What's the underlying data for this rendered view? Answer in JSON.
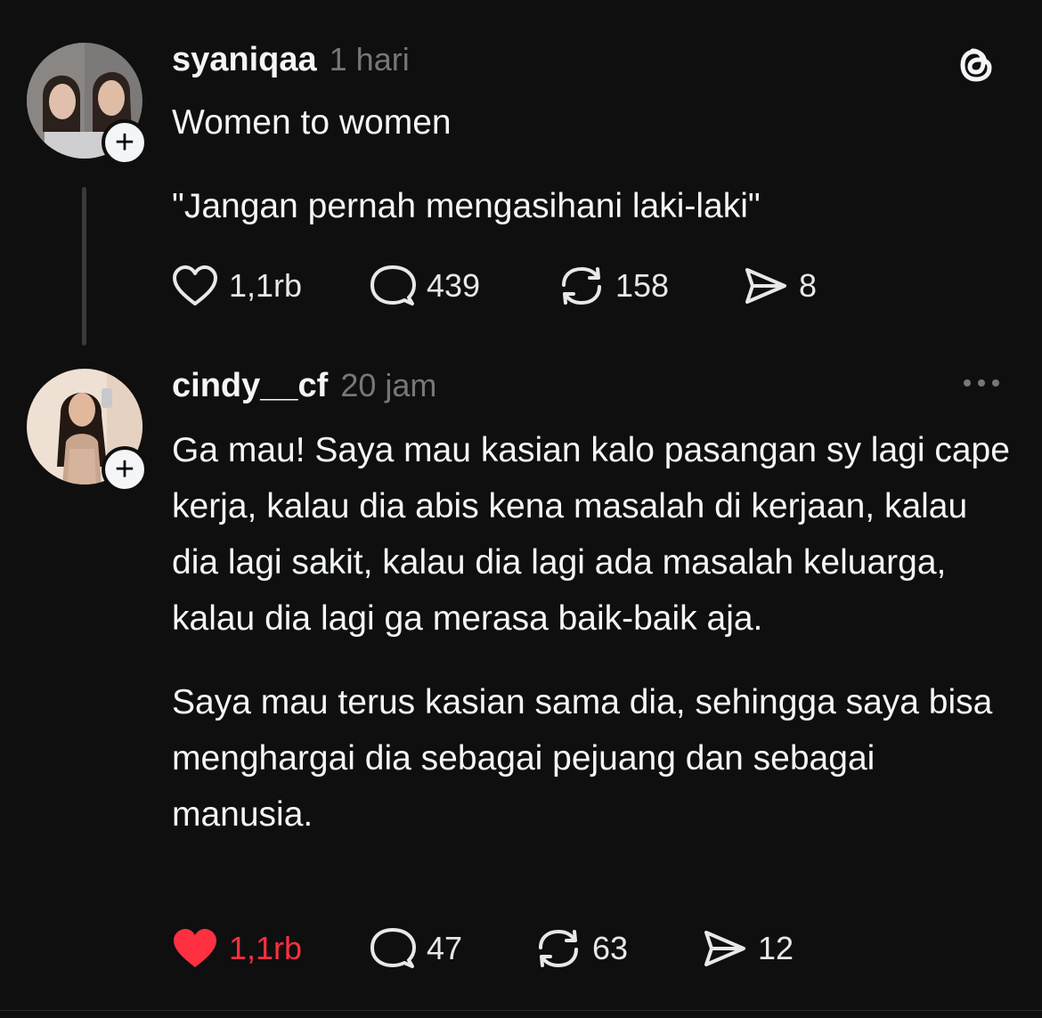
{
  "colors": {
    "background": "#0f0f10",
    "text": "#f3f5f7",
    "muted": "#777777",
    "like_active": "#ff3040"
  },
  "posts": [
    {
      "username": "syaniqaa",
      "time": "1 hari",
      "paragraphs": [
        "Women to women",
        "\"Jangan pernah mengasihani laki-laki\""
      ],
      "likes": "1,1rb",
      "replies": "439",
      "reposts": "158",
      "shares": "8",
      "liked": false,
      "icons": {
        "like": "heart-outline-icon",
        "reply": "speech-bubble-icon",
        "repost": "repost-icon",
        "share": "send-icon"
      }
    },
    {
      "username": "cindy__cf",
      "time": "20 jam",
      "paragraphs": [
        "Ga mau! Saya mau kasian kalo pasangan sy lagi cape kerja, kalau dia abis kena masalah di kerjaan, kalau dia lagi sakit, kalau dia lagi ada masalah keluarga, kalau dia lagi ga merasa baik-baik aja.",
        "Saya mau terus kasian sama dia, sehingga saya bisa menghargai dia sebagai pejuang dan sebagai manusia."
      ],
      "likes": "1,1rb",
      "replies": "47",
      "reposts": "63",
      "shares": "12",
      "liked": true,
      "icons": {
        "like": "heart-filled-icon",
        "reply": "speech-bubble-icon",
        "repost": "repost-icon",
        "share": "send-icon"
      }
    }
  ],
  "follow_badge": "+",
  "top_right_icon": "threads-logo-icon",
  "more_icon": "more-options-icon"
}
